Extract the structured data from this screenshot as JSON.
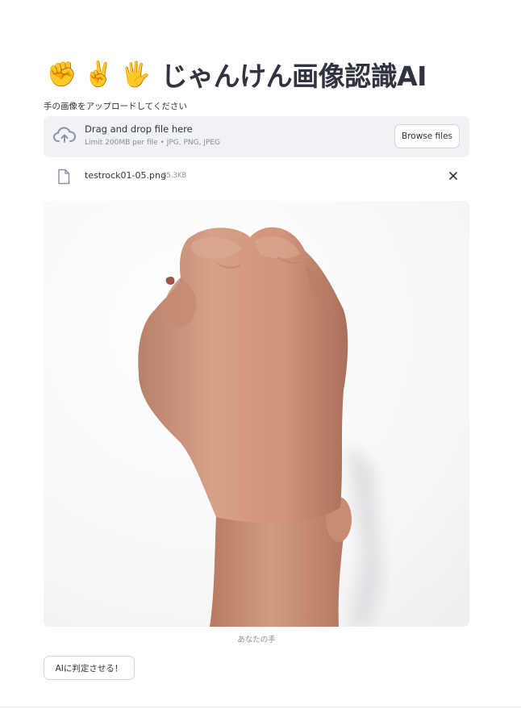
{
  "header": {
    "emojis": [
      "✊",
      "✌️",
      "🖐️"
    ],
    "title": "じゃんけん画像認識AI"
  },
  "uploader": {
    "label": "手の画像をアップロードしてください",
    "drop_title": "Drag and drop file here",
    "drop_hint": "Limit 200MB per file • JPG, PNG, JPEG",
    "browse_label": "Browse files",
    "upload_icon": "cloud-upload-icon"
  },
  "uploaded_file": {
    "name": "testrock01-05.png",
    "size": "85.3KB",
    "file_icon": "file-icon",
    "remove_icon": "close-icon"
  },
  "image": {
    "caption": "あなたの手"
  },
  "actions": {
    "predict_label": "AIに判定させる！"
  },
  "colors": {
    "text": "#31333f",
    "muted": "#8a8d98",
    "dropzone_bg": "#f0f2f6",
    "border": "#d2d4da"
  }
}
